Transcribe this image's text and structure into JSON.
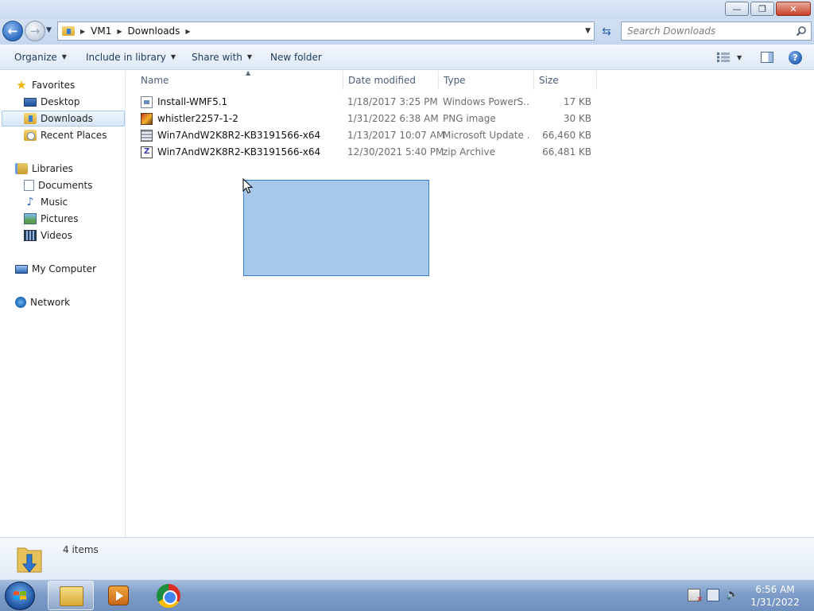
{
  "window": {
    "minimize_glyph": "—",
    "maximize_glyph": "❐",
    "close_glyph": "✕"
  },
  "address": {
    "crumbs": [
      "VM1",
      "Downloads"
    ],
    "search_placeholder": "Search Downloads"
  },
  "toolbar": {
    "organize": "Organize",
    "include_in_library": "Include in library",
    "share_with": "Share with",
    "new_folder": "New folder"
  },
  "nav": {
    "favorites": "Favorites",
    "desktop": "Desktop",
    "downloads": "Downloads",
    "recent_places": "Recent Places",
    "libraries": "Libraries",
    "documents": "Documents",
    "music": "Music",
    "pictures": "Pictures",
    "videos": "Videos",
    "my_computer": "My Computer",
    "network": "Network"
  },
  "columns": {
    "name": "Name",
    "date_modified": "Date modified",
    "type": "Type",
    "size": "Size"
  },
  "files": [
    {
      "name": "Install-WMF5.1",
      "date": "1/18/2017 3:25 PM",
      "type": "Windows PowerS...",
      "size": "17 KB",
      "icon": "powershell-script-icon"
    },
    {
      "name": "whistler2257-1-2",
      "date": "1/31/2022 6:38 AM",
      "type": "PNG image",
      "size": "30 KB",
      "icon": "png-image-icon"
    },
    {
      "name": "Win7AndW2K8R2-KB3191566-x64",
      "date": "1/13/2017 10:07 AM",
      "type": "Microsoft Update ...",
      "size": "66,460 KB",
      "icon": "msu-package-icon"
    },
    {
      "name": "Win7AndW2K8R2-KB3191566-x64",
      "date": "12/30/2021 5:40 PM",
      "type": "zip Archive",
      "size": "66,481 KB",
      "icon": "zip-archive-icon"
    }
  ],
  "status": {
    "item_count": "4 items"
  },
  "taskbar": {
    "clock_time": "6:56 AM",
    "clock_date": "1/31/2022"
  },
  "colors": {
    "selection": "#7aabe1",
    "accent": "#1e395b"
  }
}
